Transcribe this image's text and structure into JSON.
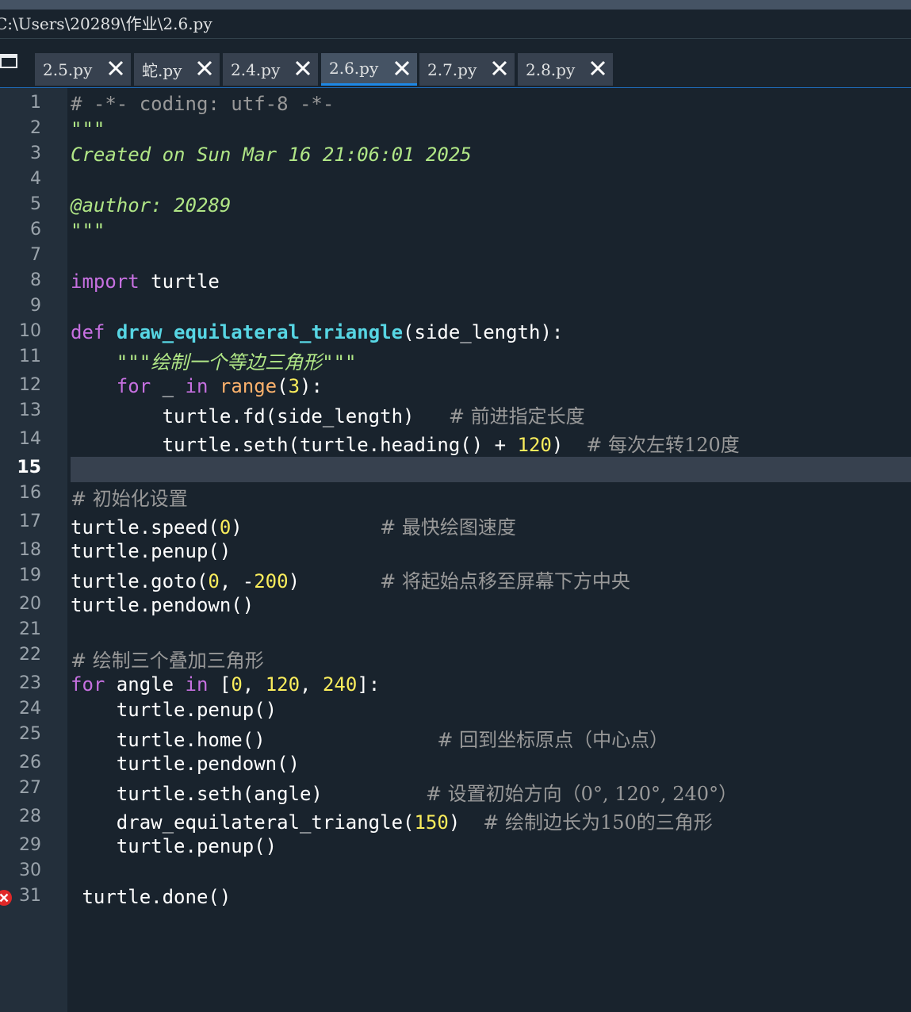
{
  "path_bar": {
    "text": "C:\\Users\\20289\\作业\\2.6.py"
  },
  "tabs": [
    {
      "label": "2.5.py",
      "active": false
    },
    {
      "label": "蛇.py",
      "active": false
    },
    {
      "label": "2.4.py",
      "active": false
    },
    {
      "label": "2.6.py",
      "active": true
    },
    {
      "label": "2.7.py",
      "active": false
    },
    {
      "label": "2.8.py",
      "active": false
    }
  ],
  "editor": {
    "current_line": 15,
    "error_line": 31,
    "line_numbers": [
      "1",
      "2",
      "3",
      "4",
      "5",
      "6",
      "7",
      "8",
      "9",
      "10",
      "11",
      "12",
      "13",
      "14",
      "15",
      "16",
      "17",
      "18",
      "19",
      "20",
      "21",
      "22",
      "23",
      "24",
      "25",
      "26",
      "27",
      "28",
      "29",
      "30",
      "31"
    ],
    "code": {
      "l1": "# -*- coding: utf-8 -*-",
      "l2": "\"\"\"",
      "l3": "Created on Sun Mar 16 21:06:01 2025",
      "l5": "@author: 20289",
      "l6": "\"\"\"",
      "l8": {
        "kw_import": "import",
        "rest": " turtle"
      },
      "l10": {
        "kw_def": "def",
        "name": "draw_equilateral_triangle",
        "rest": "(side_length):"
      },
      "l11": "    \"\"\"绘制一个等边三角形\"\"\"",
      "l12": {
        "indent": "    ",
        "kw_for": "for",
        "mid1": " _ ",
        "kw_in": "in",
        "sp": " ",
        "builtin": "range",
        "p1": "(",
        "num": "3",
        "p2": "):"
      },
      "l13": {
        "code": "        turtle.fd(side_length)",
        "gap": "   ",
        "comment": "# 前进指定长度"
      },
      "l14": {
        "code": "        turtle.seth(turtle.heading() + ",
        "num": "120",
        "code2": ")",
        "gap": "  ",
        "comment": "# 每次左转120度"
      },
      "l16": "# 初始化设置",
      "l17": {
        "code": "turtle.speed(",
        "num": "0",
        "code2": ")",
        "gap": "            ",
        "comment": "# 最快绘图速度"
      },
      "l18": "turtle.penup()",
      "l19": {
        "code": "turtle.goto(",
        "num1": "0",
        "code2": ", -",
        "num2": "200",
        "code3": ")",
        "gap": "       ",
        "comment": "# 将起始点移至屏幕下方中央"
      },
      "l20": "turtle.pendown()",
      "l22": "# 绘制三个叠加三角形",
      "l23": {
        "kw_for": "for",
        "mid": " angle ",
        "kw_in": "in",
        "b1": " [",
        "n1": "0",
        "c1": ", ",
        "n2": "120",
        "c2": ", ",
        "n3": "240",
        "b2": "]:"
      },
      "l24": "    turtle.penup()",
      "l25": {
        "code": "    turtle.home()",
        "gap": "               ",
        "comment": "# 回到坐标原点（中心点）"
      },
      "l26": "    turtle.pendown()",
      "l27": {
        "code": "    turtle.seth(angle)",
        "gap": "         ",
        "comment": "# 设置初始方向（0°, 120°, 240°）"
      },
      "l28": {
        "code": "    draw_equilateral_triangle(",
        "num": "150",
        "code2": ")",
        "gap": "  ",
        "comment": "# 绘制边长为150的三角形"
      },
      "l29": "    turtle.penup()",
      "l31": " turtle.done()"
    }
  },
  "colors": {
    "background": "#19232d",
    "gutter": "#232f3b",
    "keyword": "#c670e0",
    "function_def": "#57d6e4",
    "builtin": "#fab16c",
    "number": "#faed5c",
    "string": "#b0e686",
    "comment": "#999999",
    "active_tab_underline": "#1e88e5",
    "error": "#e02828"
  }
}
